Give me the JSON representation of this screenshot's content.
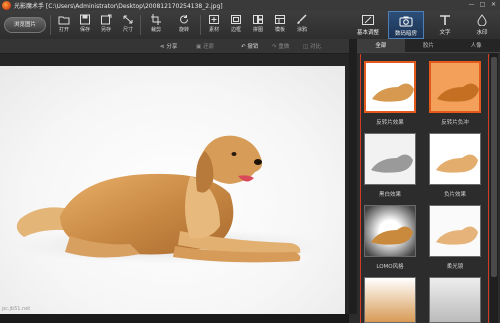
{
  "window": {
    "title": "光影魔术手 [C:\\Users\\Administrator\\Desktop\\200812170254138_2.jpg]",
    "controls": [
      "—",
      "□",
      "✕"
    ]
  },
  "toolbar": {
    "browse_label": "浏览图片",
    "tools": [
      {
        "name": "open",
        "label": "打开",
        "icon": "folder-icon"
      },
      {
        "name": "save",
        "label": "保存",
        "icon": "save-icon"
      },
      {
        "name": "save-as",
        "label": "另存",
        "icon": "save-as-icon"
      },
      {
        "name": "size",
        "label": "尺寸",
        "icon": "resize-icon"
      },
      {
        "name": "crop",
        "label": "裁剪",
        "icon": "crop-icon"
      },
      {
        "name": "rotate",
        "label": "旋转",
        "icon": "rotate-icon"
      },
      {
        "name": "material",
        "label": "素材",
        "icon": "material-icon"
      },
      {
        "name": "frame",
        "label": "边框",
        "icon": "frame-icon"
      },
      {
        "name": "collage",
        "label": "拼图",
        "icon": "collage-icon"
      },
      {
        "name": "template",
        "label": "模板",
        "icon": "template-icon"
      },
      {
        "name": "doodle",
        "label": "涂鸦",
        "icon": "brush-icon"
      }
    ],
    "modes": [
      {
        "name": "basic-adjust",
        "label": "基本调整",
        "icon": "adjust-icon"
      },
      {
        "name": "digital-darkroom",
        "label": "数码暗房",
        "icon": "camera-icon",
        "active": true
      },
      {
        "name": "text",
        "label": "文字",
        "icon": "text-icon"
      },
      {
        "name": "watermark",
        "label": "水印",
        "icon": "watermark-icon"
      }
    ]
  },
  "subbar": {
    "share": "分享",
    "restore": "还原",
    "undo": "撤销",
    "redo": "重做",
    "compare": "对比"
  },
  "canvas": {
    "watermark": "pc.jb51.net",
    "accent": "#e4591c"
  },
  "panel": {
    "tabs": [
      "全部",
      "胶片",
      "人像"
    ],
    "effects": [
      {
        "label": "反转片效果",
        "tone": "normal",
        "selected": true
      },
      {
        "label": "反转片负冲",
        "tone": "warm",
        "selected": true
      },
      {
        "label": "黑白效果",
        "tone": "bw",
        "selected": false
      },
      {
        "label": "负片效果",
        "tone": "light",
        "selected": false
      },
      {
        "label": "LOMO风格",
        "tone": "lomo",
        "selected": false
      },
      {
        "label": "柔光镜",
        "tone": "soft",
        "selected": false
      }
    ]
  }
}
